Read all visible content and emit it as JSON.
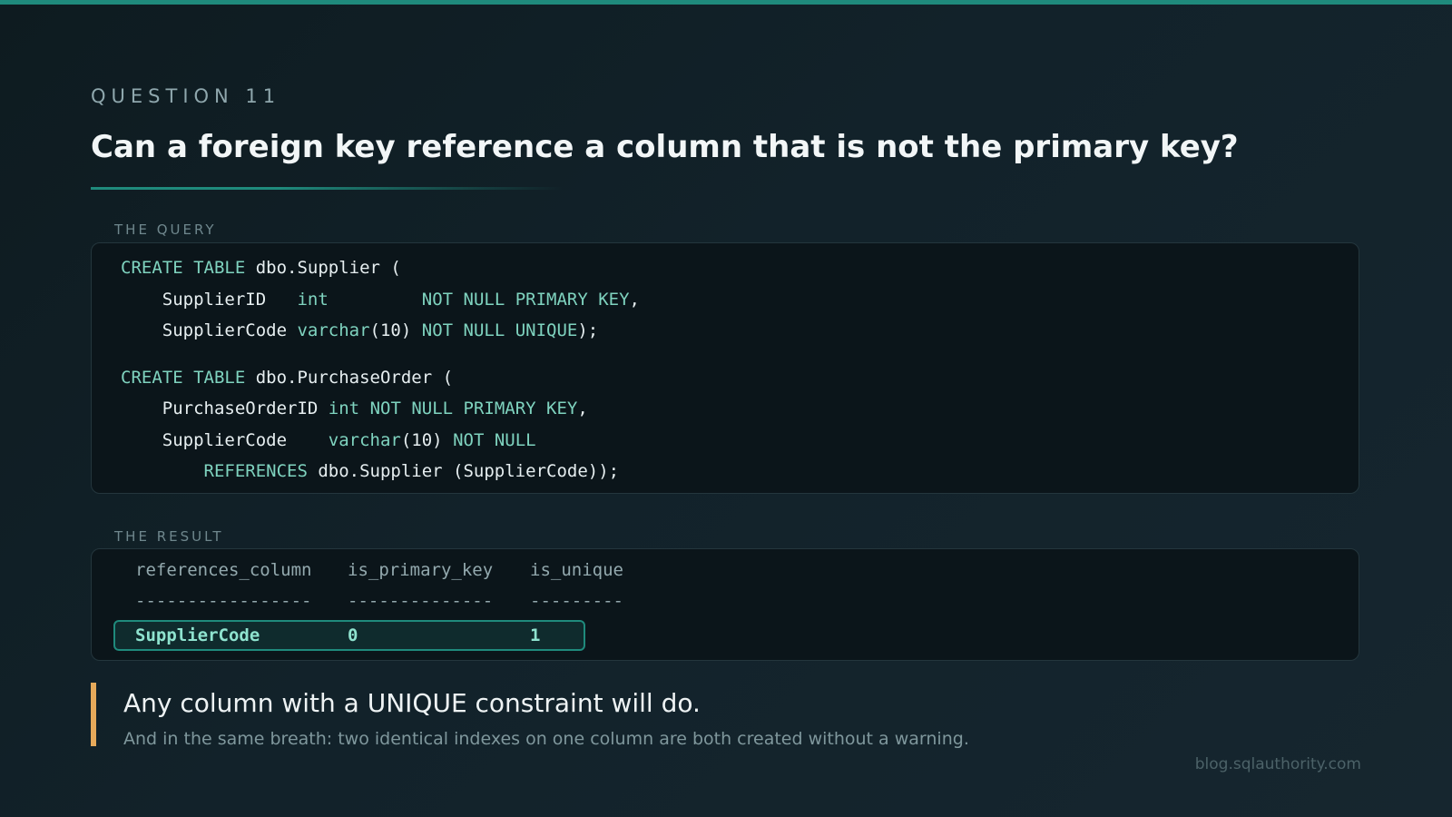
{
  "eyebrow": "QUESTION 11",
  "title": "Can a foreign key reference a column that is not the primary key?",
  "query": {
    "label": "THE QUERY",
    "lines": [
      [
        {
          "t": "CREATE TABLE",
          "k": true
        },
        {
          "t": " dbo.Supplier (",
          "k": false
        }
      ],
      [
        {
          "t": "    SupplierID   ",
          "k": false
        },
        {
          "t": "int",
          "k": true
        },
        {
          "t": "         ",
          "k": false
        },
        {
          "t": "NOT NULL PRIMARY KEY",
          "k": true
        },
        {
          "t": ",",
          "k": false
        }
      ],
      [
        {
          "t": "    SupplierCode ",
          "k": false
        },
        {
          "t": "varchar",
          "k": true
        },
        {
          "t": "(10) ",
          "k": false
        },
        {
          "t": "NOT NULL UNIQUE",
          "k": true
        },
        {
          "t": ");",
          "k": false
        }
      ],
      null,
      [
        {
          "t": "CREATE TABLE",
          "k": true
        },
        {
          "t": " dbo.PurchaseOrder (",
          "k": false
        }
      ],
      [
        {
          "t": "    PurchaseOrderID ",
          "k": false
        },
        {
          "t": "int",
          "k": true
        },
        {
          "t": " ",
          "k": false
        },
        {
          "t": "NOT NULL PRIMARY KEY",
          "k": true
        },
        {
          "t": ",",
          "k": false
        }
      ],
      [
        {
          "t": "    SupplierCode    ",
          "k": false
        },
        {
          "t": "varchar",
          "k": true
        },
        {
          "t": "(10) ",
          "k": false
        },
        {
          "t": "NOT NULL",
          "k": true
        }
      ],
      [
        {
          "t": "        ",
          "k": false
        },
        {
          "t": "REFERENCES",
          "k": true
        },
        {
          "t": " dbo.Supplier (SupplierCode));",
          "k": false
        }
      ]
    ]
  },
  "result": {
    "label": "THE RESULT",
    "columns": [
      "references_column",
      "is_primary_key",
      "is_unique"
    ],
    "separators": [
      "-----------------",
      "--------------",
      "---------"
    ],
    "rows": [
      [
        "SupplierCode",
        "0",
        "1"
      ]
    ]
  },
  "callout": {
    "main": "Any column with a UNIQUE constraint will do.",
    "sub": "And in the same breath: two identical indexes on one column are both created without a warning."
  },
  "footer": "blog.sqlauthority.com",
  "colors": {
    "accent": "#1f8a7c",
    "keyword": "#7fd3bf",
    "callout_bar": "#e6a95a"
  }
}
